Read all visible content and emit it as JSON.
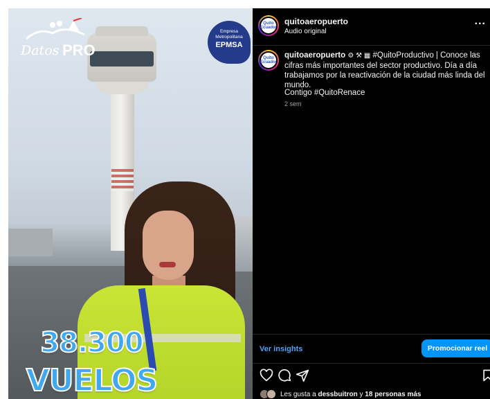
{
  "video": {
    "logo_left_script": "Datos",
    "logo_left_pro": "PRO",
    "badge_line1": "Empresa",
    "badge_line2": "Metropolitana",
    "badge_line3": "EPMSA",
    "overlay_number": "38.300",
    "overlay_word": "VUELOS"
  },
  "post": {
    "username": "quitoaeropuerto",
    "audio": "Audio original",
    "more": "...",
    "avatar_text": "Quito Ecuador",
    "caption_user": "quitoaeropuerto",
    "caption_icons": "⚙ ⚒ ▦",
    "caption_text": "#QuitoProductivo | Conoce las cifras más importantes del sector productivo. Día a día trabajamos por la reactivación de la ciudad más linda del mundo.",
    "caption_line2": "Contigo #QuitoRenace",
    "time": "2 sem",
    "insights": "Ver insights",
    "promote": "Promocionar reel",
    "likes_prefix": "Les gusta a",
    "likes_user": "dessbuitron",
    "likes_mid": "y",
    "likes_others": "18 personas más"
  },
  "icons": {
    "like": "heart-icon",
    "comment": "comment-icon",
    "share": "send-icon",
    "save": "bookmark-icon"
  },
  "colors": {
    "panel_bg": "#000000",
    "link_blue": "#4ca3f5",
    "button_blue": "#0095f6",
    "overlay_blue": "#41a8ee"
  }
}
